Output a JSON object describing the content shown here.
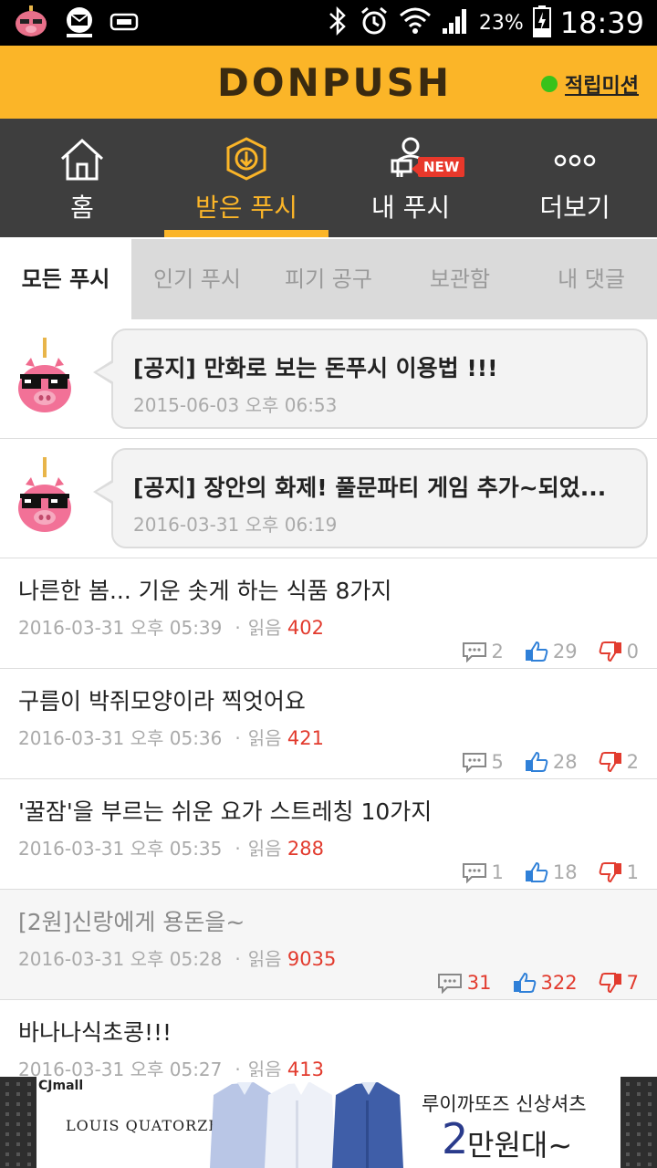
{
  "status_bar": {
    "battery": "23%",
    "time": "18:39",
    "icons": [
      "pig-app-icon",
      "mail-icon",
      "tray-icon",
      "bluetooth-icon",
      "alarm-icon",
      "wifi-icon",
      "signal-icon",
      "battery-charging-icon"
    ]
  },
  "header": {
    "logo": "DONPUSH",
    "mission_label": "적립미션"
  },
  "nav": {
    "items": [
      {
        "label": "홈",
        "icon": "home-icon"
      },
      {
        "label": "받은 푸시",
        "icon": "push-inbox-icon"
      },
      {
        "label": "내 푸시",
        "icon": "my-push-icon",
        "badge": "NEW"
      },
      {
        "label": "더보기",
        "icon": "more-icon"
      }
    ],
    "active_index": 1
  },
  "subtabs": [
    "모든 푸시",
    "인기 푸시",
    "피기 공구",
    "보관함",
    "내 댓글"
  ],
  "notices": [
    {
      "title": "[공지] 만화로 보는 돈푸시 이용법 !!!",
      "date": "2015-06-03 오후 06:53"
    },
    {
      "title": "[공지] 장안의 화제! 풀문파티 게임 추가~되었...",
      "date": "2016-03-31 오후 06:19"
    }
  ],
  "reads_label": "읽음",
  "posts": [
    {
      "title": "나른한 봄... 기운 솟게 하는 식품 8가지",
      "date": "2016-03-31 오후 05:39",
      "reads": "402",
      "comments": "2",
      "likes": "29",
      "dislikes": "0",
      "read": false
    },
    {
      "title": "구름이 박쥐모양이라 찍엇어요",
      "date": "2016-03-31 오후 05:36",
      "reads": "421",
      "comments": "5",
      "likes": "28",
      "dislikes": "2",
      "read": false
    },
    {
      "title": "'꿀잠'을 부르는 쉬운 요가 스트레칭 10가지",
      "date": "2016-03-31 오후 05:35",
      "reads": "288",
      "comments": "1",
      "likes": "18",
      "dislikes": "1",
      "read": false
    },
    {
      "title": "[2원]신랑에게 용돈을~",
      "date": "2016-03-31 오후 05:28",
      "reads": "9035",
      "comments": "31",
      "likes": "322",
      "dislikes": "7",
      "read": true,
      "hot": true
    },
    {
      "title": "바나나식초콩!!!",
      "date": "2016-03-31 오후 05:27",
      "reads": "413",
      "read": false
    }
  ],
  "ad": {
    "mall": "CJmall",
    "brand": "LOUIS QUATORZE",
    "copy_top": "루이까또즈 신상셔츠",
    "copy_num": "2",
    "copy_rest": "만원대~"
  },
  "colors": {
    "brand_yellow": "#fbb528",
    "nav_dark": "#3e3e3e",
    "accent_red": "#e23b2e",
    "like_blue": "#2f80d8",
    "mission_green": "#39c21a"
  }
}
